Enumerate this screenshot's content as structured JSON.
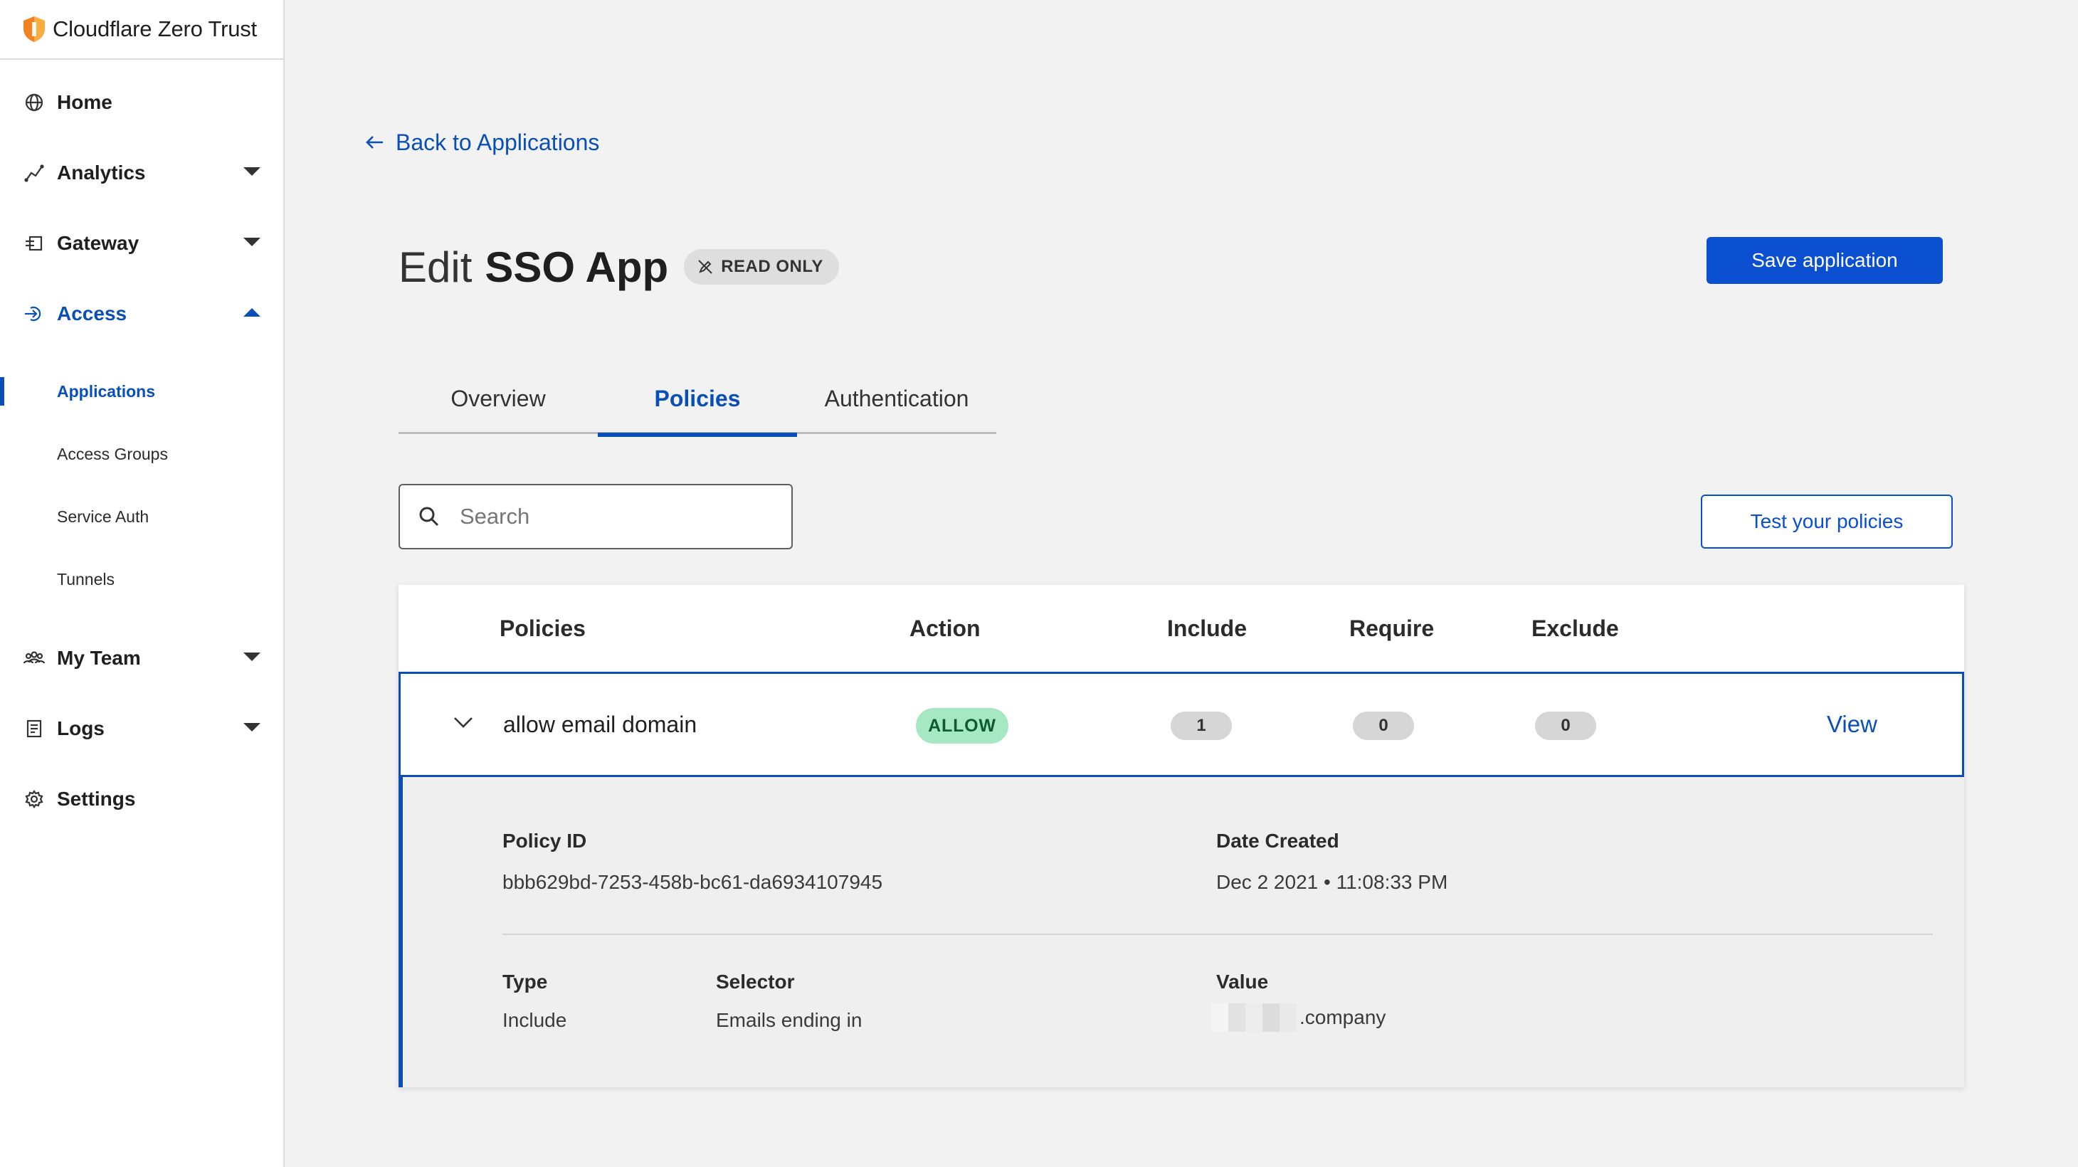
{
  "brand": {
    "name": "Cloudflare Zero Trust"
  },
  "sidebar": {
    "items": [
      {
        "label": "Home",
        "icon": "globe-icon"
      },
      {
        "label": "Analytics",
        "icon": "analytics-icon"
      },
      {
        "label": "Gateway",
        "icon": "gateway-icon"
      },
      {
        "label": "Access",
        "icon": "access-icon"
      },
      {
        "label": "My Team",
        "icon": "team-icon"
      },
      {
        "label": "Logs",
        "icon": "logs-icon"
      },
      {
        "label": "Settings",
        "icon": "gear-icon"
      }
    ],
    "access_sub": [
      "Applications",
      "Access Groups",
      "Service Auth",
      "Tunnels"
    ]
  },
  "back_link": "Back to Applications",
  "header": {
    "prefix": "Edit",
    "app_name": "SSO App",
    "badge": "READ ONLY",
    "save_label": "Save application"
  },
  "tabs": [
    "Overview",
    "Policies",
    "Authentication"
  ],
  "search": {
    "placeholder": "Search",
    "value": ""
  },
  "test_button": "Test your policies",
  "table": {
    "columns": [
      "Policies",
      "Action",
      "Include",
      "Require",
      "Exclude"
    ],
    "row": {
      "name": "allow email domain",
      "action": "ALLOW",
      "include": "1",
      "require": "0",
      "exclude": "0",
      "view_label": "View"
    },
    "details": {
      "policy_id_label": "Policy ID",
      "policy_id": "bbb629bd-7253-458b-bc61-da6934107945",
      "date_label": "Date Created",
      "date": "Dec 2 2021 • 11:08:33 PM",
      "type_label": "Type",
      "type": "Include",
      "selector_label": "Selector",
      "selector": "Emails ending in",
      "value_label": "Value",
      "value_suffix": ".company"
    }
  },
  "colors": {
    "accent": "#0a4fb6",
    "primary_button": "#0a4fcf",
    "allow_pill": "#a6e8c4",
    "brand_orange": "#f48120"
  }
}
